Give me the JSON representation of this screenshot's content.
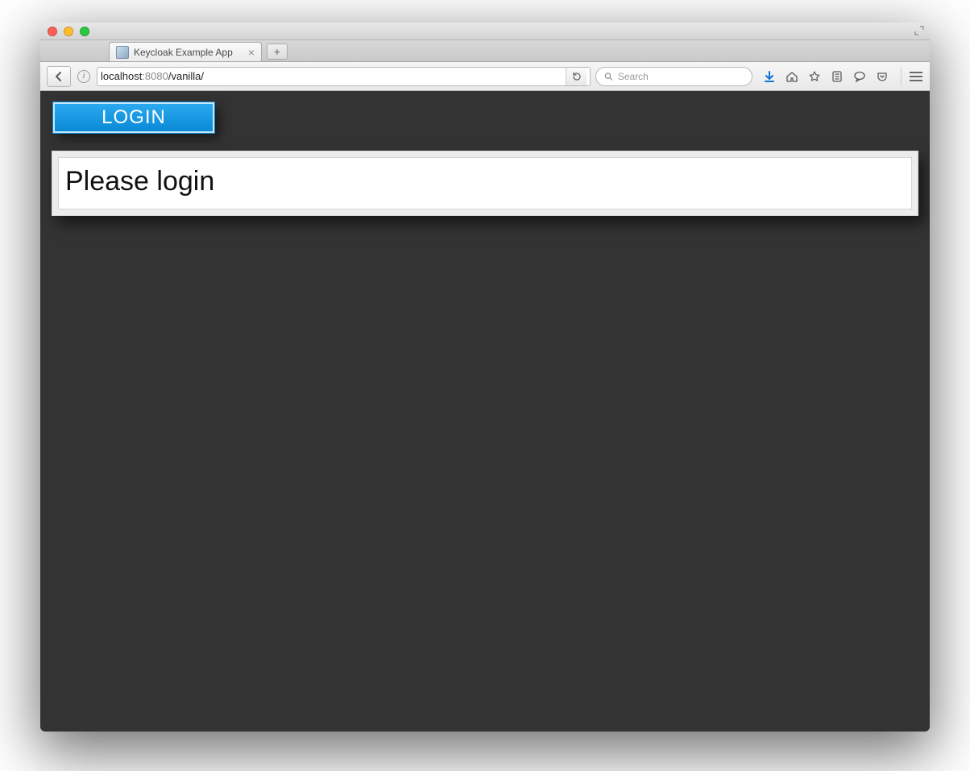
{
  "window": {
    "tab_title": "Keycloak Example App"
  },
  "url": {
    "host": "localhost",
    "port": ":8080",
    "path": "/vanilla/"
  },
  "search": {
    "placeholder": "Search"
  },
  "page": {
    "login_button": "LOGIN",
    "heading": "Please login"
  }
}
